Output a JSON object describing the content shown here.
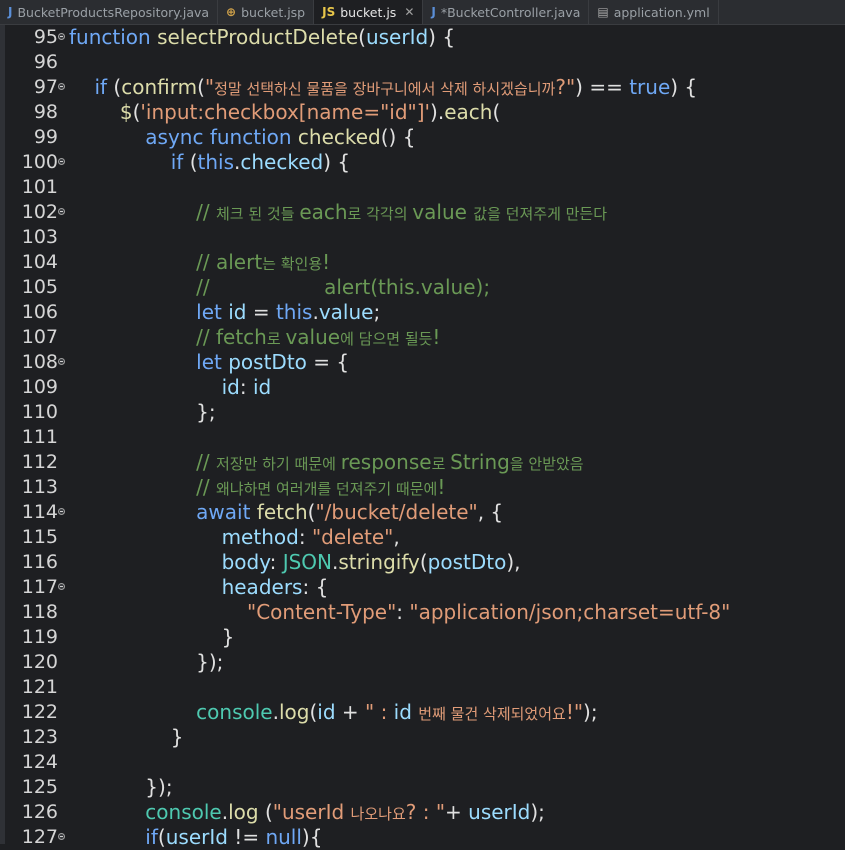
{
  "tabs": [
    {
      "label": "BucketProductsRepository.java",
      "icon": "java-file-icon",
      "glyph": "J",
      "active": false
    },
    {
      "label": "bucket.jsp",
      "icon": "jsp-file-icon",
      "glyph": "⊕",
      "active": false
    },
    {
      "label": "bucket.js",
      "icon": "js-file-icon",
      "glyph": "JS",
      "active": true
    },
    {
      "label": "*BucketController.java",
      "icon": "java-file-icon",
      "glyph": "J",
      "active": false
    },
    {
      "label": "application.yml",
      "icon": "yml-file-icon",
      "glyph": "▤",
      "active": false
    }
  ],
  "close_glyph": "✕",
  "lines": [
    {
      "n": "95",
      "fold": true,
      "tokens": [
        [
          "kw",
          "function "
        ],
        [
          "fn",
          "selectProductDelete"
        ],
        [
          "plain",
          "("
        ],
        [
          "var",
          "userId"
        ],
        [
          "plain",
          ") {"
        ]
      ]
    },
    {
      "n": "96",
      "fold": false,
      "tokens": []
    },
    {
      "n": "97",
      "fold": true,
      "tokens": [
        [
          "plain",
          "    "
        ],
        [
          "kw",
          "if "
        ],
        [
          "plain",
          "("
        ],
        [
          "fn",
          "confirm"
        ],
        [
          "plain",
          "("
        ],
        [
          "str",
          "\""
        ],
        [
          "str kr",
          "정말 선택하신 물품을 장바구니에서 삭제 하시겠습니까"
        ],
        [
          "str",
          "?\""
        ],
        [
          "plain",
          ") == "
        ],
        [
          "kw",
          "true"
        ],
        [
          "plain",
          ") {"
        ]
      ]
    },
    {
      "n": "98",
      "fold": false,
      "tokens": [
        [
          "plain",
          "        "
        ],
        [
          "fn",
          "$"
        ],
        [
          "plain",
          "("
        ],
        [
          "str",
          "'input:checkbox[name=\"id\"]'"
        ],
        [
          "plain",
          ")."
        ],
        [
          "fn",
          "each"
        ],
        [
          "plain",
          "("
        ]
      ]
    },
    {
      "n": "99",
      "fold": false,
      "tokens": [
        [
          "plain",
          "            "
        ],
        [
          "kw",
          "async function "
        ],
        [
          "fn",
          "checked"
        ],
        [
          "plain",
          "() {"
        ]
      ]
    },
    {
      "n": "100",
      "fold": true,
      "tokens": [
        [
          "plain",
          "                "
        ],
        [
          "kw",
          "if "
        ],
        [
          "plain",
          "("
        ],
        [
          "kw",
          "this"
        ],
        [
          "plain",
          "."
        ],
        [
          "var",
          "checked"
        ],
        [
          "plain",
          ") {"
        ]
      ]
    },
    {
      "n": "101",
      "fold": false,
      "tokens": []
    },
    {
      "n": "102",
      "fold": true,
      "tokens": [
        [
          "plain",
          "                    "
        ],
        [
          "cm",
          "// "
        ],
        [
          "cm kr",
          "체크 된 것들 "
        ],
        [
          "cm",
          "each"
        ],
        [
          "cm kr",
          "로 각각의 "
        ],
        [
          "cm",
          "value "
        ],
        [
          "cm kr",
          "값을 던져주게 만든다"
        ]
      ]
    },
    {
      "n": "103",
      "fold": false,
      "tokens": []
    },
    {
      "n": "104",
      "fold": false,
      "tokens": [
        [
          "plain",
          "                    "
        ],
        [
          "cm",
          "// alert"
        ],
        [
          "cm kr",
          "는 확인용"
        ],
        [
          "cm",
          "!"
        ]
      ]
    },
    {
      "n": "105",
      "fold": false,
      "tokens": [
        [
          "plain",
          "                    "
        ],
        [
          "cm",
          "//                  alert(this.value);"
        ]
      ]
    },
    {
      "n": "106",
      "fold": false,
      "tokens": [
        [
          "plain",
          "                    "
        ],
        [
          "kw",
          "let "
        ],
        [
          "var",
          "id"
        ],
        [
          "plain",
          " = "
        ],
        [
          "kw",
          "this"
        ],
        [
          "plain",
          "."
        ],
        [
          "var",
          "value"
        ],
        [
          "plain",
          ";"
        ]
      ]
    },
    {
      "n": "107",
      "fold": false,
      "tokens": [
        [
          "plain",
          "                    "
        ],
        [
          "cm",
          "// fetch"
        ],
        [
          "cm kr",
          "로 "
        ],
        [
          "cm",
          "value"
        ],
        [
          "cm kr",
          "에 담으면 될듯"
        ],
        [
          "cm",
          "!"
        ]
      ]
    },
    {
      "n": "108",
      "fold": true,
      "tokens": [
        [
          "plain",
          "                    "
        ],
        [
          "kw",
          "let "
        ],
        [
          "var",
          "postDto"
        ],
        [
          "plain",
          " = {"
        ]
      ]
    },
    {
      "n": "109",
      "fold": false,
      "tokens": [
        [
          "plain",
          "                        "
        ],
        [
          "var",
          "id"
        ],
        [
          "plain",
          ": "
        ],
        [
          "var",
          "id"
        ]
      ]
    },
    {
      "n": "110",
      "fold": false,
      "tokens": [
        [
          "plain",
          "                    };"
        ]
      ]
    },
    {
      "n": "111",
      "fold": false,
      "tokens": []
    },
    {
      "n": "112",
      "fold": false,
      "tokens": [
        [
          "plain",
          "                    "
        ],
        [
          "cm",
          "// "
        ],
        [
          "cm kr",
          "저장만 하기 때문에 "
        ],
        [
          "cm",
          "response"
        ],
        [
          "cm kr",
          "로 "
        ],
        [
          "cm",
          "String"
        ],
        [
          "cm kr",
          "을 안받았음"
        ]
      ]
    },
    {
      "n": "113",
      "fold": false,
      "tokens": [
        [
          "plain",
          "                    "
        ],
        [
          "cm",
          "// "
        ],
        [
          "cm kr",
          "왜냐하면 여러개를 던져주기 때문에"
        ],
        [
          "cm",
          "!"
        ]
      ]
    },
    {
      "n": "114",
      "fold": true,
      "tokens": [
        [
          "plain",
          "                    "
        ],
        [
          "kw",
          "await "
        ],
        [
          "fn",
          "fetch"
        ],
        [
          "plain",
          "("
        ],
        [
          "str",
          "\"/bucket/delete\""
        ],
        [
          "plain",
          ", {"
        ]
      ]
    },
    {
      "n": "115",
      "fold": false,
      "tokens": [
        [
          "plain",
          "                        "
        ],
        [
          "var",
          "method"
        ],
        [
          "plain",
          ": "
        ],
        [
          "str",
          "\"delete\""
        ],
        [
          "plain",
          ","
        ]
      ]
    },
    {
      "n": "116",
      "fold": false,
      "tokens": [
        [
          "plain",
          "                        "
        ],
        [
          "var",
          "body"
        ],
        [
          "plain",
          ": "
        ],
        [
          "obj",
          "JSON"
        ],
        [
          "plain",
          "."
        ],
        [
          "fn",
          "stringify"
        ],
        [
          "plain",
          "("
        ],
        [
          "var",
          "postDto"
        ],
        [
          "plain",
          "),"
        ]
      ]
    },
    {
      "n": "117",
      "fold": true,
      "tokens": [
        [
          "plain",
          "                        "
        ],
        [
          "var",
          "headers"
        ],
        [
          "plain",
          ": {"
        ]
      ]
    },
    {
      "n": "118",
      "fold": false,
      "tokens": [
        [
          "plain",
          "                            "
        ],
        [
          "str",
          "\"Content-Type\""
        ],
        [
          "plain",
          ": "
        ],
        [
          "str",
          "\"application/json;charset=utf-8\""
        ]
      ]
    },
    {
      "n": "119",
      "fold": false,
      "tokens": [
        [
          "plain",
          "                        }"
        ]
      ]
    },
    {
      "n": "120",
      "fold": false,
      "tokens": [
        [
          "plain",
          "                    });"
        ]
      ]
    },
    {
      "n": "121",
      "fold": false,
      "tokens": []
    },
    {
      "n": "122",
      "fold": false,
      "tokens": [
        [
          "plain",
          "                    "
        ],
        [
          "obj",
          "console"
        ],
        [
          "plain",
          "."
        ],
        [
          "fn",
          "log"
        ],
        [
          "plain",
          "("
        ],
        [
          "var",
          "id"
        ],
        [
          "plain",
          " + "
        ],
        [
          "str",
          "\" : "
        ],
        [
          "var",
          "id "
        ],
        [
          "str kr",
          "번째 물건 삭제되었어요"
        ],
        [
          "str",
          "!\""
        ],
        [
          "plain",
          ");"
        ]
      ]
    },
    {
      "n": "123",
      "fold": false,
      "tokens": [
        [
          "plain",
          "                }"
        ]
      ]
    },
    {
      "n": "124",
      "fold": false,
      "tokens": []
    },
    {
      "n": "125",
      "fold": false,
      "tokens": [
        [
          "plain",
          "            });"
        ]
      ]
    },
    {
      "n": "126",
      "fold": false,
      "tokens": [
        [
          "plain",
          "            "
        ],
        [
          "obj",
          "console"
        ],
        [
          "plain",
          "."
        ],
        [
          "fn",
          "log "
        ],
        [
          "plain",
          "("
        ],
        [
          "str",
          "\"userId "
        ],
        [
          "str kr",
          "나오나요"
        ],
        [
          "str",
          "? : \""
        ],
        [
          "plain",
          "+ "
        ],
        [
          "var",
          "userId"
        ],
        [
          "plain",
          ");"
        ]
      ]
    },
    {
      "n": "127",
      "fold": true,
      "tokens": [
        [
          "plain",
          "            "
        ],
        [
          "kw",
          "if"
        ],
        [
          "plain",
          "("
        ],
        [
          "var",
          "userId"
        ],
        [
          "plain",
          " != "
        ],
        [
          "kw",
          "null"
        ],
        [
          "plain",
          "){"
        ]
      ]
    }
  ]
}
